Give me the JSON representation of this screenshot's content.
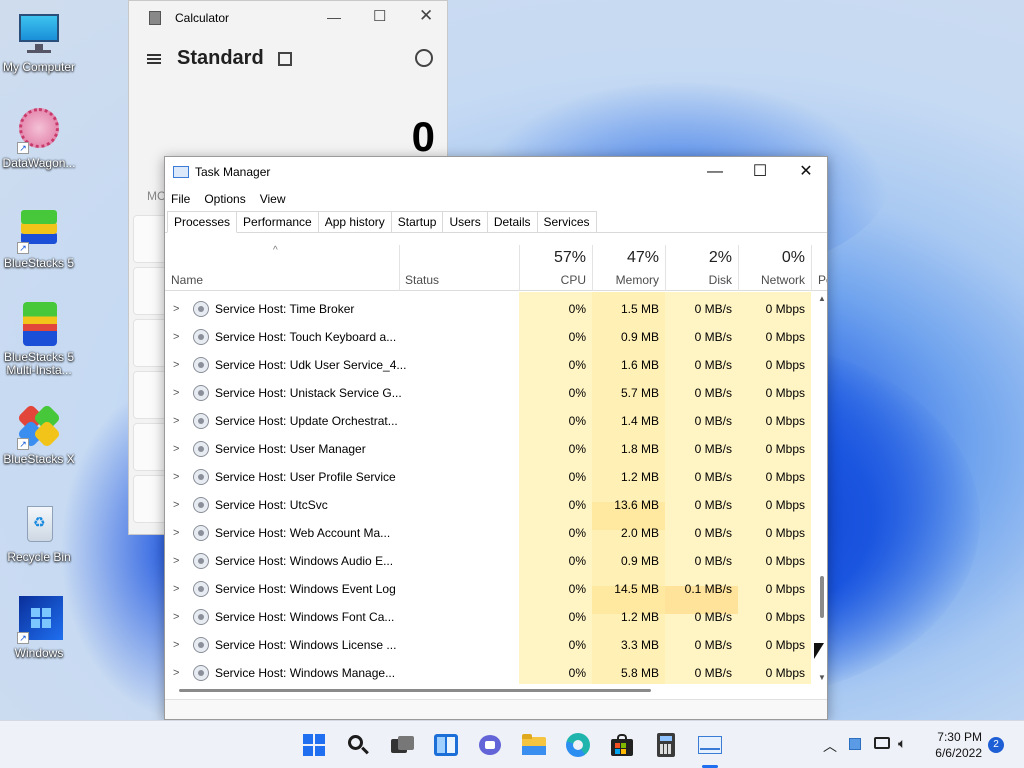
{
  "desktop": {
    "icons": [
      {
        "label": "My Computer",
        "icon": "monitor-icon"
      },
      {
        "label": "DataWagon...",
        "icon": "datawagon-icon"
      },
      {
        "label": "BlueStacks 5",
        "icon": "bluestacks-icon"
      },
      {
        "label": "BlueStacks 5 Multi-Insta...",
        "icon": "bluestacks-multi-icon"
      },
      {
        "label": "BlueStacks X",
        "icon": "bluestacks-x-icon"
      },
      {
        "label": "Recycle Bin",
        "icon": "recycle-bin-icon"
      },
      {
        "label": "Windows",
        "icon": "windows-folder-icon"
      }
    ]
  },
  "calculator": {
    "title": "Calculator",
    "mode": "Standard",
    "display": "0",
    "memory_label": "MC"
  },
  "task_manager": {
    "title": "Task Manager",
    "menu": [
      "File",
      "Options",
      "View"
    ],
    "tabs": [
      "Processes",
      "Performance",
      "App history",
      "Startup",
      "Users",
      "Details",
      "Services"
    ],
    "active_tab": "Processes",
    "columns": {
      "name": "Name",
      "status": "Status",
      "cpu": {
        "pct": "57%",
        "label": "CPU"
      },
      "memory": {
        "pct": "47%",
        "label": "Memory"
      },
      "disk": {
        "pct": "2%",
        "label": "Disk"
      },
      "network": {
        "pct": "0%",
        "label": "Network"
      },
      "power": {
        "label": "Po"
      }
    },
    "rows": [
      {
        "name": "Service Host: Time Broker",
        "cpu": "0%",
        "memory": "1.5 MB",
        "disk": "0 MB/s",
        "network": "0 Mbps"
      },
      {
        "name": "Service Host: Touch Keyboard a...",
        "cpu": "0%",
        "memory": "0.9 MB",
        "disk": "0 MB/s",
        "network": "0 Mbps"
      },
      {
        "name": "Service Host: Udk User Service_4...",
        "cpu": "0%",
        "memory": "1.6 MB",
        "disk": "0 MB/s",
        "network": "0 Mbps"
      },
      {
        "name": "Service Host: Unistack Service G...",
        "cpu": "0%",
        "memory": "5.7 MB",
        "disk": "0 MB/s",
        "network": "0 Mbps"
      },
      {
        "name": "Service Host: Update Orchestrat...",
        "cpu": "0%",
        "memory": "1.4 MB",
        "disk": "0 MB/s",
        "network": "0 Mbps"
      },
      {
        "name": "Service Host: User Manager",
        "cpu": "0%",
        "memory": "1.8 MB",
        "disk": "0 MB/s",
        "network": "0 Mbps"
      },
      {
        "name": "Service Host: User Profile Service",
        "cpu": "0%",
        "memory": "1.2 MB",
        "disk": "0 MB/s",
        "network": "0 Mbps"
      },
      {
        "name": "Service Host: UtcSvc",
        "cpu": "0%",
        "memory": "13.6 MB",
        "disk": "0 MB/s",
        "network": "0 Mbps"
      },
      {
        "name": "Service Host: Web Account Ma...",
        "cpu": "0%",
        "memory": "2.0 MB",
        "disk": "0 MB/s",
        "network": "0 Mbps"
      },
      {
        "name": "Service Host: Windows Audio E...",
        "cpu": "0%",
        "memory": "0.9 MB",
        "disk": "0 MB/s",
        "network": "0 Mbps"
      },
      {
        "name": "Service Host: Windows Event Log",
        "cpu": "0%",
        "memory": "14.5 MB",
        "disk": "0.1 MB/s",
        "network": "0 Mbps"
      },
      {
        "name": "Service Host: Windows Font Ca...",
        "cpu": "0%",
        "memory": "1.2 MB",
        "disk": "0 MB/s",
        "network": "0 Mbps"
      },
      {
        "name": "Service Host: Windows License ...",
        "cpu": "0%",
        "memory": "3.3 MB",
        "disk": "0 MB/s",
        "network": "0 Mbps"
      },
      {
        "name": "Service Host: Windows Manage...",
        "cpu": "0%",
        "memory": "5.8 MB",
        "disk": "0 MB/s",
        "network": "0 Mbps"
      }
    ]
  },
  "taskbar": {
    "apps": [
      "start-icon",
      "search-icon",
      "task-view-icon",
      "widgets-icon",
      "teams-chat-icon",
      "file-explorer-icon",
      "edge-icon",
      "store-icon",
      "calculator-icon",
      "task-manager-icon"
    ],
    "time": "7:30 PM",
    "date": "6/6/2022",
    "notification_count": "2"
  }
}
